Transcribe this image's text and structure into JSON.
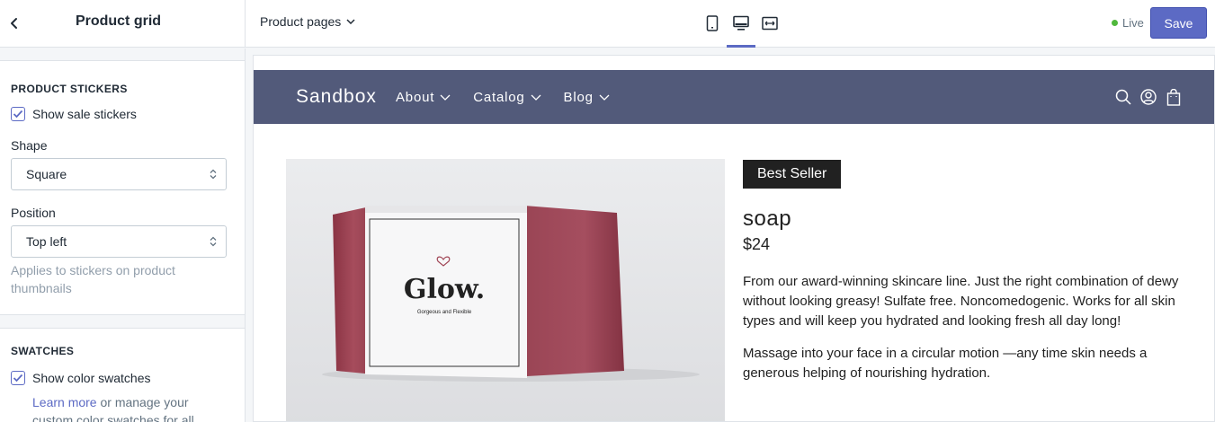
{
  "topbar": {
    "panel_title": "Product grid",
    "page_select": "Product pages",
    "status": "Live",
    "save_label": "Save"
  },
  "sidebar": {
    "stickers": {
      "title": "PRODUCT STICKERS",
      "show_sale_label": "Show sale stickers",
      "show_sale_checked": true,
      "shape_label": "Shape",
      "shape_value": "Square",
      "position_label": "Position",
      "position_value": "Top left",
      "help": "Applies to stickers on product thumbnails"
    },
    "swatches": {
      "title": "SWATCHES",
      "show_label": "Show color swatches",
      "show_checked": true,
      "learn_more": "Learn more",
      "help_rest": " or manage your custom color swatches for all"
    }
  },
  "store": {
    "brand": "Sandbox",
    "nav": [
      "About",
      "Catalog",
      "Blog"
    ],
    "nav_color": "#525a7a"
  },
  "product": {
    "badge": "Best Seller",
    "title": "soap",
    "price": "$24",
    "description": "From our award-winning skincare line. Just the right combination of dewy without looking greasy! Sulfate free. Noncomedogenic. Works for all skin types and will keep you hydrated and looking fresh all day long!",
    "description2": "Massage into your face in a circular motion —any time skin needs a generous helping of nourishing hydration.",
    "box_brand": "Glow.",
    "box_sub": "Gorgeous and Flexible"
  },
  "colors": {
    "accent": "#5c6ac4",
    "live": "#50b83c",
    "soap": "#a04555"
  }
}
